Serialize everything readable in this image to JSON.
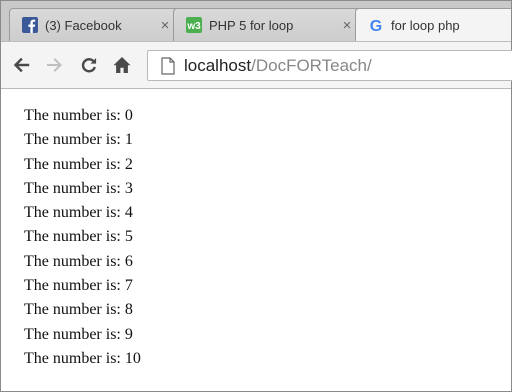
{
  "tabs": [
    {
      "label": "(3) Facebook",
      "icon": "facebook-icon",
      "close": "×"
    },
    {
      "label": "PHP 5 for loop",
      "icon": "w3schools-icon",
      "favicon_text": "w3",
      "close": "×"
    },
    {
      "label": "for loop php",
      "icon": "google-icon",
      "favicon_text": "G",
      "close": ""
    }
  ],
  "toolbar": {
    "back_icon": "back-arrow-icon",
    "forward_icon": "forward-arrow-icon",
    "reload_icon": "reload-icon",
    "home_icon": "home-icon"
  },
  "address": {
    "host": "localhost",
    "path": "/DocFORTeach/"
  },
  "content": {
    "lines": [
      "The number is: 0",
      "The number is: 1",
      "The number is: 2",
      "The number is: 3",
      "The number is: 4",
      "The number is: 5",
      "The number is: 6",
      "The number is: 7",
      "The number is: 8",
      "The number is: 9",
      "The number is: 10"
    ]
  },
  "colors": {
    "facebook": "#3b5998",
    "w3schools": "#4caf50",
    "google_blue": "#4285f4"
  }
}
